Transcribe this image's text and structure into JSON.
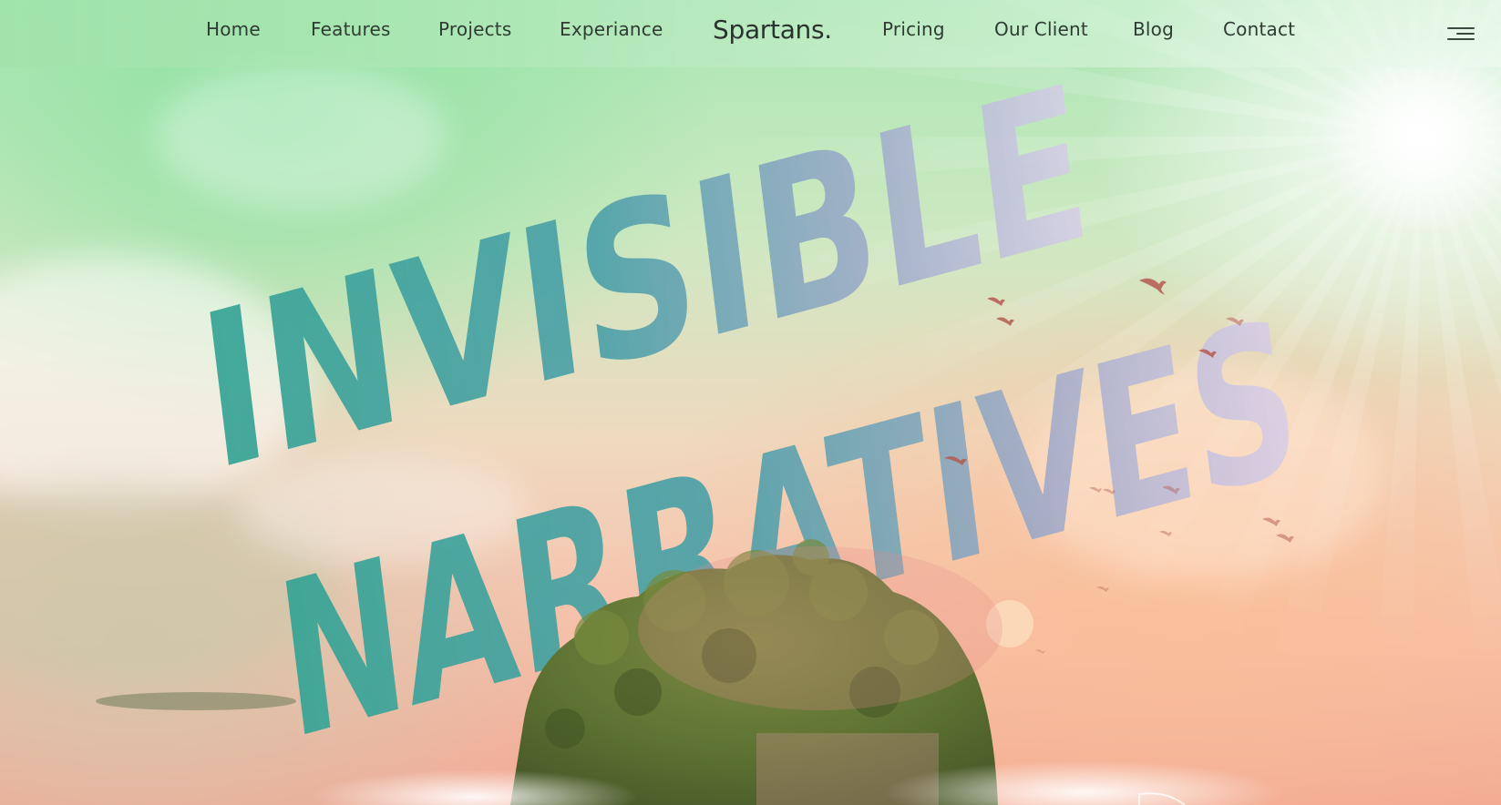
{
  "nav": {
    "links_left": [
      "Home",
      "Features",
      "Projects",
      "Experiance"
    ],
    "brand": "Spartans.",
    "links_right": [
      "Pricing",
      "Our Client",
      "Blog",
      "Contact"
    ],
    "menu_icon": "hamburger-menu-icon"
  },
  "hero": {
    "headline_line1": "INVISIBLE",
    "headline_line2": "NARRATIVES"
  },
  "colors": {
    "headline_teal": "#3fa89a",
    "headline_lavender": "#c9bde0",
    "nav_text": "#2f3b33"
  }
}
